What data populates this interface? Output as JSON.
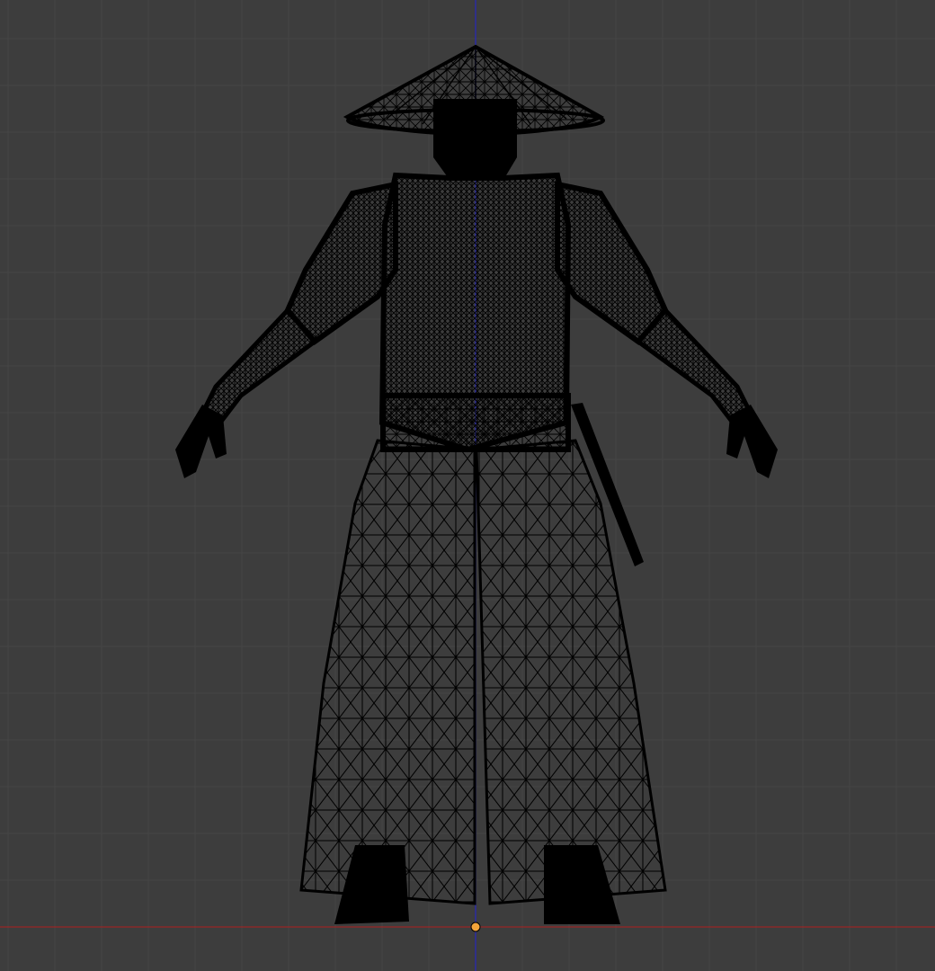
{
  "viewport": {
    "background_color": "#3d3d3d",
    "grid_color": "#454545",
    "x_axis_color": "#8a2a2a",
    "z_axis_color": "#2a2aa8",
    "wire_color": "#000000",
    "origin_color": "#f2a33a"
  },
  "scene": {
    "object": "character-wireframe-mesh",
    "shading": "wireframe",
    "view": "front-orthographic"
  }
}
